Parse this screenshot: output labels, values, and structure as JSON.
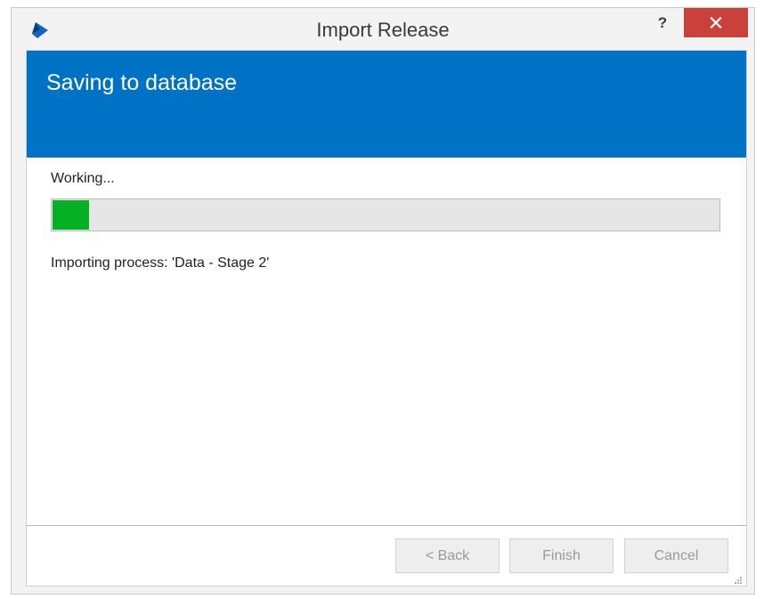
{
  "window": {
    "title": "Import Release",
    "help_label": "?"
  },
  "banner": {
    "title": "Saving to database"
  },
  "progress": {
    "status_label": "Working...",
    "fraction": 0.055,
    "fill_color": "#06b025",
    "detail": "Importing process: 'Data - Stage 2'"
  },
  "buttons": {
    "back": "< Back",
    "finish": "Finish",
    "cancel": "Cancel"
  },
  "colors": {
    "banner": "#0072c6",
    "close": "#c9413a"
  },
  "icons": {
    "app": "app-logo-icon",
    "close": "close-icon",
    "grip": "resize-grip-icon"
  }
}
